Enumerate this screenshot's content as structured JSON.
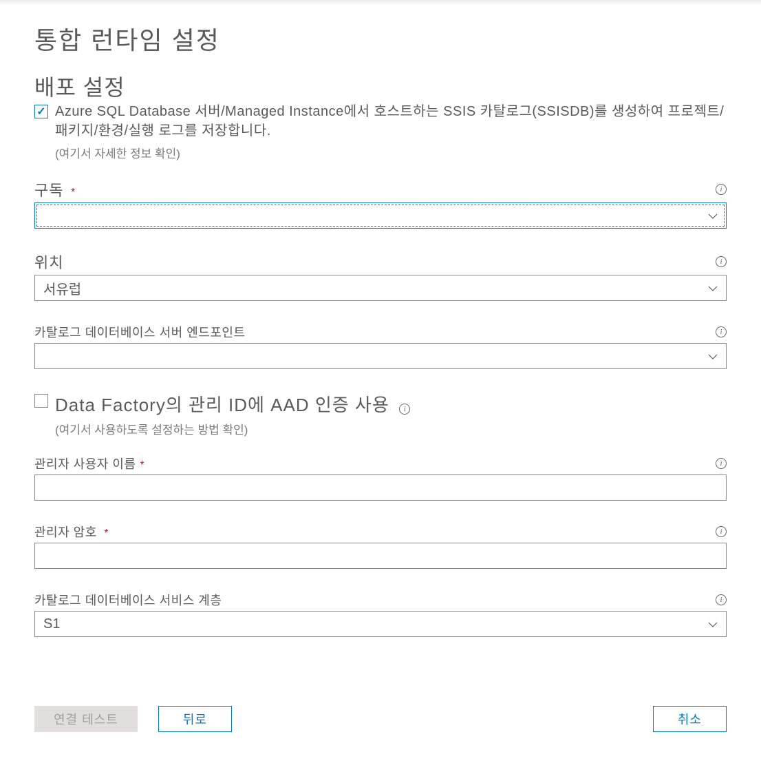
{
  "title": "통합 런타임 설정",
  "section": "배포 설정",
  "ssisdb": {
    "text": "Azure SQL Database 서버/Managed Instance에서 호스트하는 SSIS 카탈로그(SSISDB)를 생성하여 프로젝트/패키지/환경/실행 로그를 저장합니다.",
    "link": "(여기서 자세한 정보 확인)"
  },
  "fields": {
    "subscription": {
      "label": "구독",
      "value": ""
    },
    "location": {
      "label": "위치",
      "value": "서유럽"
    },
    "endpoint": {
      "label": "카탈로그 데이터베이스 서버 엔드포인트",
      "value": ""
    },
    "aad": {
      "label": "Data Factory의 관리 ID에 AAD 인증 사용",
      "link": "(여기서 사용하도록 설정하는 방법 확인)"
    },
    "adminUser": {
      "label": "관리자 사용자 이름",
      "value": ""
    },
    "adminPassword": {
      "label": "관리자 암호",
      "value": ""
    },
    "serviceTier": {
      "label": "카탈로그 데이터베이스 서비스 계층",
      "value": "S1"
    }
  },
  "buttons": {
    "testConnection": "연결 테스트",
    "back": "뒤로",
    "cancel": "취소"
  }
}
